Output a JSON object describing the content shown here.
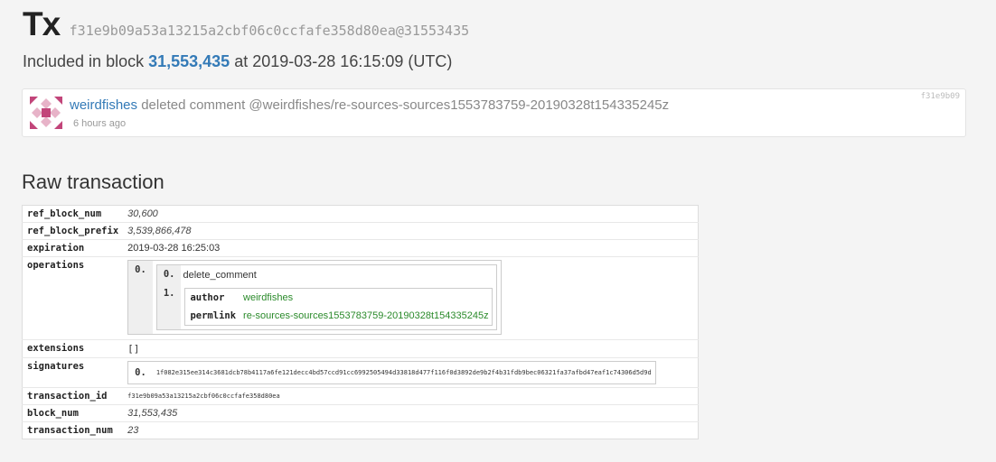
{
  "header": {
    "title": "Tx",
    "hash": "f31e9b09a53a13215a2cbf06c0ccfafe358d80ea@31553435"
  },
  "included": {
    "prefix": "Included in block",
    "block": "31,553,435",
    "suffix": "at 2019-03-28 16:15:09 (UTC)"
  },
  "operation": {
    "user": "weirdfishes",
    "action": "deleted comment @weirdfishes/re-sources-sources1553783759-20190328t154335245z",
    "time": "6 hours ago",
    "tag": "f31e9b09"
  },
  "raw": {
    "title": "Raw transaction",
    "ref_block_num_key": "ref_block_num",
    "ref_block_num": "30,600",
    "ref_block_prefix_key": "ref_block_prefix",
    "ref_block_prefix": "3,539,866,478",
    "expiration_key": "expiration",
    "expiration": "2019-03-28 16:25:03",
    "operations_key": "operations",
    "op_index": "0.",
    "op_type_index": "0.",
    "op_type": "delete_comment",
    "op_body_index": "1.",
    "author_key": "author",
    "author": "weirdfishes",
    "permlink_key": "permlink",
    "permlink": "re-sources-sources1553783759-20190328t154335245z",
    "extensions_key": "extensions",
    "extensions": "[]",
    "signatures_key": "signatures",
    "sig_index": "0.",
    "signature": "1f082e315ee314c3681dcb78b4117a6fe121decc4bd57ccd91cc6992505494d33818d477f116f0d3892de9b2f4b31fdb9bec06321fa37afbd47eaf1c74306d5d9d",
    "transaction_id_key": "transaction_id",
    "transaction_id": "f31e9b09a53a13215a2cbf06c0ccfafe358d80ea",
    "block_num_key": "block_num",
    "block_num": "31,553,435",
    "transaction_num_key": "transaction_num",
    "transaction_num": "23"
  },
  "colors": {
    "link": "#337ab7",
    "green": "#2a8a2a",
    "avatar_pink": "#c2457a"
  }
}
